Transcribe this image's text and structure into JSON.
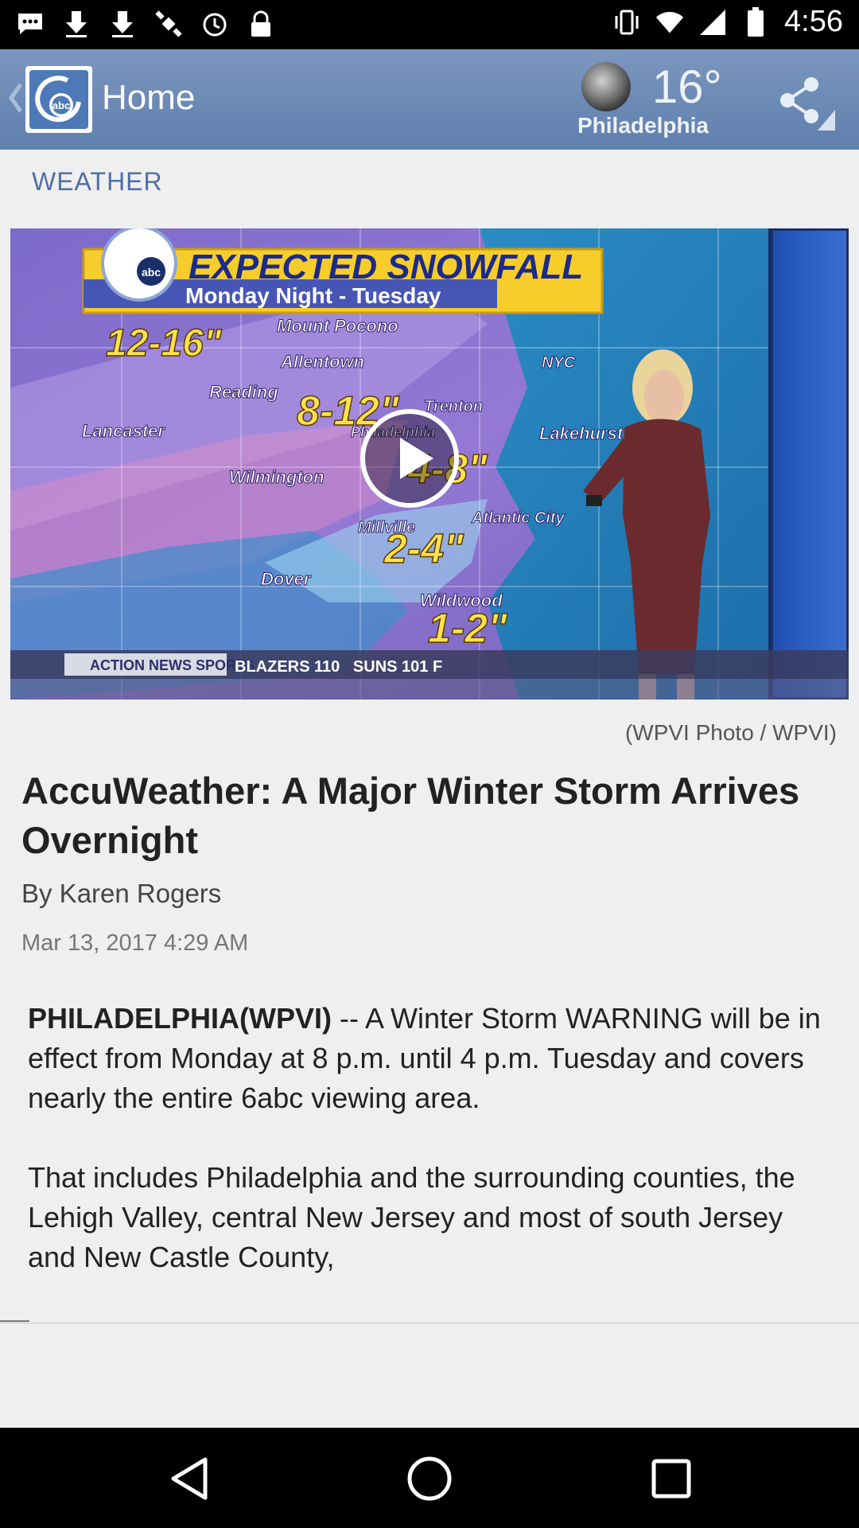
{
  "status_bar": {
    "time": "4:56",
    "left_icons": [
      "chat-icon",
      "download-icon",
      "download-icon",
      "satellite-icon",
      "alarm-icon",
      "lock-icon"
    ],
    "right_icons": [
      "vibrate-icon",
      "wifi-icon",
      "signal-icon",
      "battery-icon"
    ]
  },
  "app_bar": {
    "title": "Home",
    "weather": {
      "temperature": "16°",
      "city": "Philadelphia"
    }
  },
  "section_label": "WEATHER",
  "video": {
    "graphic": {
      "banner_title": "EXPECTED SNOWFALL",
      "banner_subtitle": "Monday Night - Tuesday",
      "places": [
        "Mount Pocono",
        "Allentown",
        "Reading",
        "Lancaster",
        "Wilmington",
        "Philadelphia",
        "Trenton",
        "NYC",
        "Lakehurst",
        "Millville",
        "Atlantic City",
        "Dover",
        "Wildwood"
      ],
      "amounts": [
        "12-16\"",
        "8-12\"",
        "4-8\"",
        "2-4\"",
        "1-2\""
      ],
      "ticker_logo": "ACTION NEWS SPORTS",
      "ticker": "BLAZERS 110   SUNS 101 F"
    }
  },
  "article": {
    "photo_credit": "(WPVI Photo / WPVI)",
    "headline": "AccuWeather: A Major Winter Storm Arrives Overnight",
    "byline": "By Karen Rogers",
    "date": "Mar 13, 2017 4:29 AM",
    "dateline": "PHILADELPHIA(WPVI)",
    "para1": " -- A Winter Storm WARNING will be in effect from Monday at 8 p.m. until 4 p.m. Tuesday and covers nearly the entire 6abc viewing area.",
    "para2": "That includes Philadelphia and the surrounding counties, the Lehigh Valley, central New Jersey and most of south Jersey and New Castle County,"
  },
  "colors": {
    "app_bar": "#6b89b6",
    "accent": "#4e6fa8",
    "content_bg": "#efefef"
  }
}
